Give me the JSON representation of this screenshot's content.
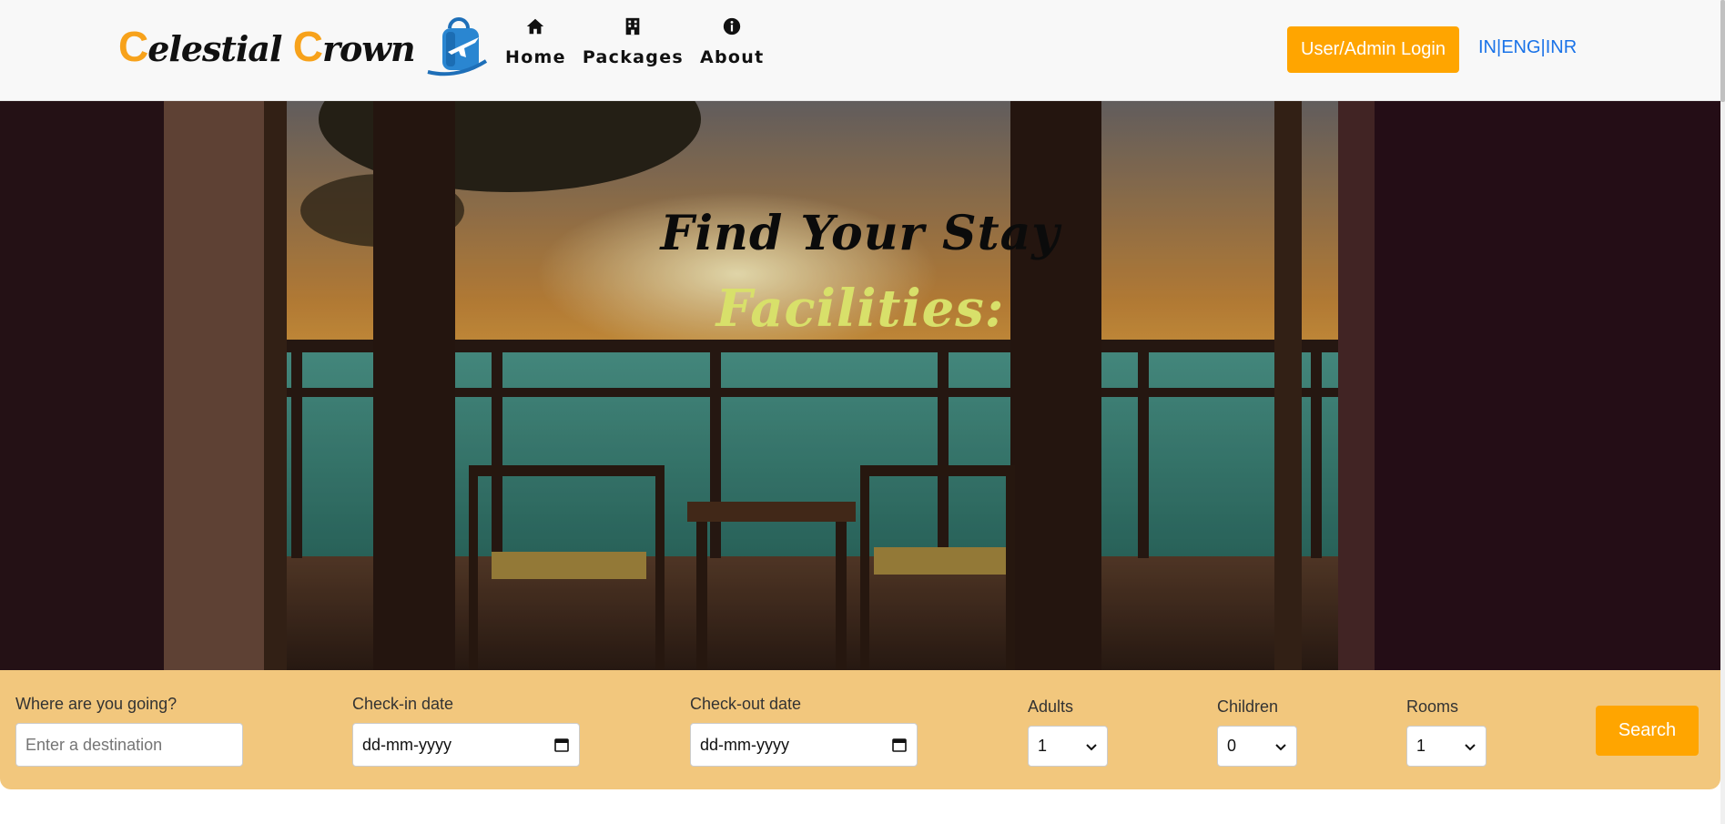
{
  "brand": {
    "name_part1_cap": "C",
    "name_part1_rest": "elestial ",
    "name_part2_cap": "C",
    "name_part2_rest": "rown",
    "logo_icon": "travel-bag-plane-icon"
  },
  "nav": {
    "items": [
      {
        "label": "Home",
        "icon": "home-icon"
      },
      {
        "label": "Packages",
        "icon": "building-icon"
      },
      {
        "label": "About",
        "icon": "info-icon"
      }
    ],
    "login_label": "User/Admin Login",
    "locale_label": "IN|ENG|INR"
  },
  "hero": {
    "title": "Find Your Stay",
    "subtitle": "Facilities:"
  },
  "search": {
    "destination_label": "Where are you going?",
    "destination_placeholder": "Enter a destination",
    "checkin_label": "Check-in date",
    "checkin_value": "dd-mm-yyyy",
    "checkout_label": "Check-out date",
    "checkout_value": "dd-mm-yyyy",
    "adults_label": "Adults",
    "adults_value": "1",
    "children_label": "Children",
    "children_value": "0",
    "rooms_label": "Rooms",
    "rooms_value": "1",
    "button_label": "Search"
  },
  "colors": {
    "accent": "#ffa500",
    "search_bar_bg": "#f2c77d",
    "link": "#1a73e8",
    "subtitle": "#d8e06a"
  }
}
